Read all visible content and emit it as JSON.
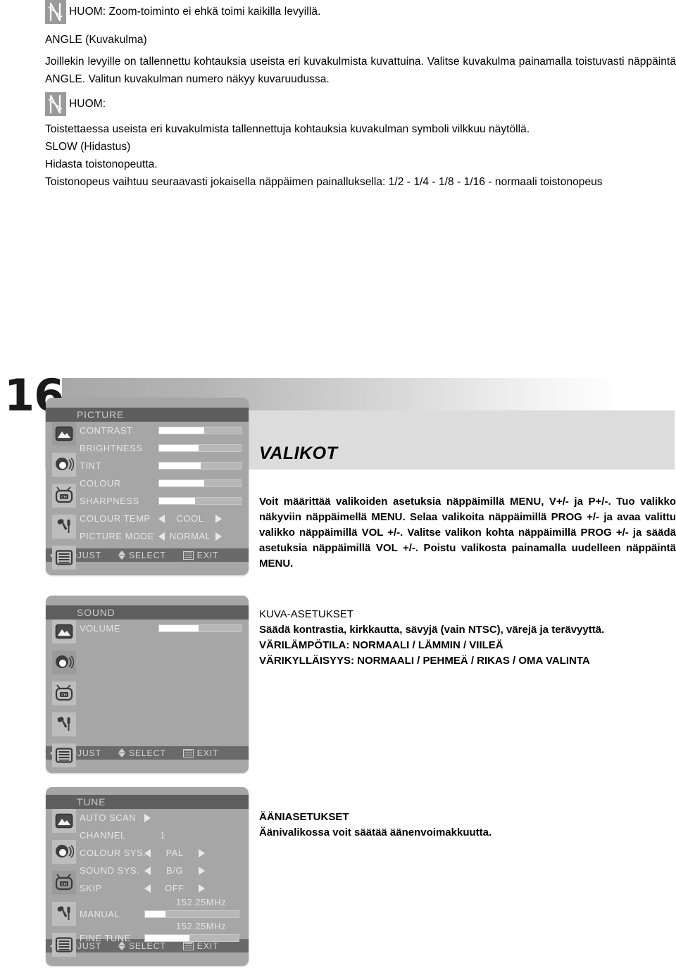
{
  "document": {
    "page_number": "16",
    "note1": {
      "icon": "note-n-icon",
      "text": "HUOM: Zoom-toiminto ei ehkä toimi kaikilla levyillä."
    },
    "section_angle": {
      "heading": "ANGLE (Kuvakulma)",
      "paragraph": "Joillekin levyille on tallennettu kohtauksia useista eri kuvakulmista kuvattuina. Valitse kuvakulma painamalla toistuvasti näppäintä ANGLE. Valitun kuvakulman numero näkyy kuvaruudussa."
    },
    "note2": {
      "icon": "note-n-icon",
      "text": "HUOM:",
      "body": "Toistettaessa useista eri kuvakulmista tallennettuja  kohtauksia kuvakulman symboli vilkkuu näytöllä."
    },
    "section_slow": {
      "heading": "SLOW (Hidastus)",
      "line1": "Hidasta toistonopeutta.",
      "line2": "Toistonopeus vaihtuu seuraavasti jokaisella näppäimen painalluksella: 1/2 - 1/4 - 1/8 - 1/16 - normaali toistonopeus"
    }
  },
  "osd_picture": {
    "title": "PICTURE",
    "icons": [
      "picture-icon",
      "sound-icon",
      "channel-icon",
      "setup-icon",
      "list-icon"
    ],
    "selected_icon_index": 0,
    "rows": [
      {
        "label": "CONTRAST",
        "type": "bar",
        "fill_percent": 55
      },
      {
        "label": "BRIGHTNESS",
        "type": "bar",
        "fill_percent": 48
      },
      {
        "label": "TINT",
        "type": "bar",
        "fill_percent": 51
      },
      {
        "label": "COLOUR",
        "type": "bar",
        "fill_percent": 55
      },
      {
        "label": "SHARPNESS",
        "type": "bar",
        "fill_percent": 44
      },
      {
        "label": "COLOUR TEMP",
        "type": "select",
        "value": "COOL"
      },
      {
        "label": "PICTURE MODE",
        "type": "select",
        "value": "NORMAL"
      }
    ],
    "footer": {
      "adjust": "ADJUST",
      "select": "SELECT",
      "exit": "EXIT"
    }
  },
  "osd_sound": {
    "title": "SOUND",
    "icons": [
      "picture-icon",
      "sound-icon",
      "channel-icon",
      "setup-icon",
      "list-icon"
    ],
    "selected_icon_index": 1,
    "rows": [
      {
        "label": "VOLUME",
        "type": "bar",
        "fill_percent": 48
      }
    ],
    "footer": {
      "adjust": "ADJUST",
      "select": "SELECT",
      "exit": "EXIT"
    }
  },
  "osd_tune": {
    "title": "TUNE",
    "icons": [
      "picture-icon",
      "sound-icon",
      "channel-icon",
      "setup-icon",
      "list-icon"
    ],
    "selected_icon_index": 2,
    "rows": [
      {
        "label": "AUTO  SCAN",
        "type": "action",
        "value": ""
      },
      {
        "label": "CHANNEL",
        "type": "value",
        "value": "1"
      },
      {
        "label": "COLOUR SYS.",
        "type": "select",
        "value": "PAL"
      },
      {
        "label": "SOUND SYS.",
        "type": "select",
        "value": "B/G"
      },
      {
        "label": "SKIP",
        "type": "select",
        "value": "OFF"
      },
      {
        "label": "MANUAL",
        "type": "bar",
        "fill_percent": 22,
        "above": "152.25MHz"
      },
      {
        "label": "FINE  TUNE",
        "type": "bar",
        "fill_percent": 47,
        "above": "152.25MHz"
      }
    ],
    "footer": {
      "adjust": "ADJUST",
      "select": "SELECT",
      "exit": "EXIT"
    }
  },
  "right_column": {
    "valikot_title": "VALIKOT",
    "valikot_body": "Voit määrittää valikoiden asetuksia näppäimillä MENU, V+/- ja P+/-. Tuo valikko näkyviin näppäimellä MENU. Selaa valikoita näppäimillä PROG +/- ja avaa valittu valikko näppäimillä VOL +/-. Valitse valikon kohta näppäimillä PROG +/- ja säädä asetuksia näppäimillä VOL +/-. Poistu valikosta painamalla uudelleen näppäintä MENU.",
    "kuva_title": "KUVA-ASETUKSET",
    "kuva_line1": "Säädä kontrastia, kirkkautta, sävyjä (vain NTSC), värejä ja terävyyttä.",
    "kuva_line2": "VÄRILÄMPÖTILA: NORMAALI / LÄMMIN / VIILEÄ",
    "kuva_line3": "VÄRIKYLLÄISYYS: NORMAALI / PEHMEÄ / RIKAS / OMA VALINTA",
    "aani_title": "ÄÄNIASETUKSET",
    "aani_line1": "Äänivalikossa voit säätää äänenvoimakkuutta."
  },
  "colors": {
    "osd_panel": "#a6a6a6",
    "osd_title_bar": "#5e5e5e",
    "osd_footer_bar": "#6a6a6a",
    "osd_text": "#e6e6e6",
    "bar_fill": "#ffffff",
    "band_light": "#dcdcdc",
    "note_icon_bg": "#9a9a9a"
  }
}
